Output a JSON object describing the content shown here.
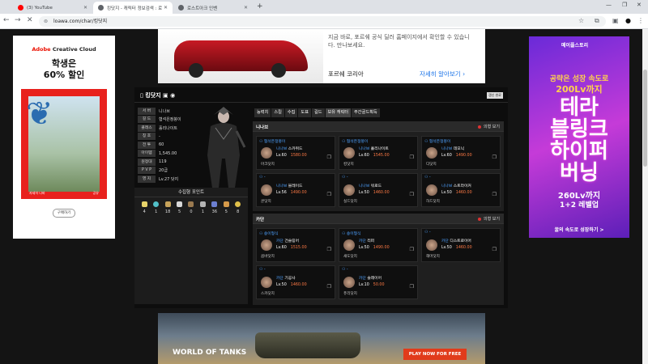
{
  "browser": {
    "tabs": [
      {
        "title": "(3) YouTube",
        "color": "#ff0000"
      },
      {
        "title": "킹닷지 - 캐릭터 정보검색 : 로",
        "color": "#5f6368"
      },
      {
        "title": "로스트아크 인벤",
        "color": "#5f6368"
      }
    ],
    "url": "loawa.com/char/킹닷지"
  },
  "ad_left": {
    "brand_a": "Adobe",
    "brand_b": " Creative Cloud",
    "line1": "학생은",
    "line2": "60% 할인",
    "cta1": "자세히 나바",
    "cta2": "공유",
    "buy": "구매하기"
  },
  "ad_top": {
    "text": "지금 바로, 포르쉐 공식 딜러 홈페이지에서 확인할 수 있습니다. 만나보세요.",
    "brand": "포르쉐 코리아",
    "more": "자세히 알아보기 ›"
  },
  "ad_right": {
    "logo": "메이플스토리",
    "s1": "공략은 성장 속도로",
    "s2": "200Lv까지",
    "big1": "테라",
    "big2": "블링크",
    "big3": "하이퍼",
    "big4": "버닝",
    "s3": "260Lv까지",
    "s4": "1+2 레벨업",
    "s5": "꿀의 속도로 성장하기 >"
  },
  "profile": {
    "name": "킹닷지",
    "refresh": "갱신 완료",
    "rows": [
      {
        "k": "서 버",
        "v": "니나브"
      },
      {
        "k": "길 드",
        "v": "협석은정붕이"
      },
      {
        "k": "클래스",
        "v": "홀리나이트"
      },
      {
        "k": "칭 호",
        "v": "-"
      },
      {
        "k": "전 투",
        "v": "60"
      },
      {
        "k": "아이템",
        "v": "1,545.00"
      },
      {
        "k": "원정대",
        "v": "119"
      },
      {
        "k": "P V P",
        "v": "20급"
      },
      {
        "k": "영 지",
        "v": "Lv.27 닷지"
      }
    ],
    "collect_title": "수집형 포인트",
    "collect_values": [
      "4",
      "1",
      "18",
      "5",
      "0",
      "1",
      "36",
      "5",
      "8"
    ],
    "tabs": [
      "능력치",
      "스킬",
      "수집",
      "도표",
      "길드",
      "보유 캐릭터",
      "주간골드획득"
    ],
    "hide_label": "의형 보기",
    "sections": [
      {
        "title": "니나브",
        "cards": [
          {
            "guild": "협석은정붕이",
            "server": "니나브",
            "name": "스카위드",
            "lv": "Lv.60",
            "ilvl": "1580.00",
            "cls": "아크닷지"
          },
          {
            "guild": "협석은정붕이",
            "server": "니나브",
            "name": "홀리나이트",
            "lv": "Lv.60",
            "ilvl": "1545.00",
            "cls": "킹닷지"
          },
          {
            "guild": "협석은정붕이",
            "server": "니나브",
            "name": "데모닉",
            "lv": "Lv.60",
            "ilvl": "1490.00",
            "cls": "디닷지"
          },
          {
            "guild": "-",
            "server": "니나브",
            "name": "블레이드",
            "lv": "Lv.56",
            "ilvl": "1490.00",
            "cls": "쿤닷지"
          },
          {
            "guild": "-",
            "server": "니나브",
            "name": "워로드",
            "lv": "Lv.50",
            "ilvl": "1460.00",
            "cls": "실드닷지"
          },
          {
            "guild": "-",
            "server": "니나브",
            "name": "스트라이커",
            "lv": "Lv.50",
            "ilvl": "1460.00",
            "cls": "하드닷지"
          }
        ]
      },
      {
        "title": "카단",
        "cards": [
          {
            "guild": "송이형식",
            "server": "카단",
            "name": "건슬링어",
            "lv": "Lv.60",
            "ilvl": "1515.00",
            "cls": "콤바닷지"
          },
          {
            "guild": "송이형식",
            "server": "카단",
            "name": "리퍼",
            "lv": "Lv.50",
            "ilvl": "1490.00",
            "cls": "섀도닷지"
          },
          {
            "guild": "-",
            "server": "카단",
            "name": "디스트로이어",
            "lv": "Lv.50",
            "ilvl": "1460.00",
            "cls": "해머닷지"
          },
          {
            "guild": "-",
            "server": "카단",
            "name": "기공사",
            "lv": "Lv.50",
            "ilvl": "1460.00",
            "cls": "스카닷지"
          },
          {
            "guild": "-",
            "server": "카단",
            "name": "슬레이어",
            "lv": "Lv.10",
            "ilvl": "50.00",
            "cls": "퓨리닷지"
          }
        ]
      }
    ]
  },
  "ad_bottom": {
    "logo": "WORLD OF TANKS",
    "cta": "PLAY NOW FOR FREE"
  }
}
